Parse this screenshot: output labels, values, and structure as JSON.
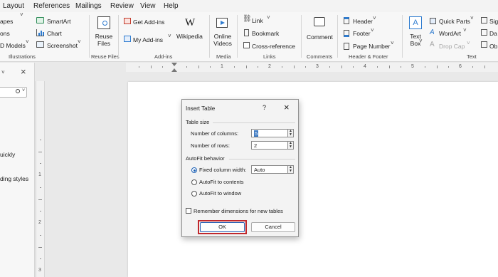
{
  "menubar": {
    "items": [
      "Layout",
      "References",
      "Mailings",
      "Review",
      "View",
      "Help"
    ]
  },
  "ribbon": {
    "illustrations": {
      "shapes": "apes",
      "smartart": "SmartArt",
      "icons": "ons",
      "chart": "Chart",
      "models": "D Models",
      "screenshot": "Screenshot",
      "label": "Illustrations"
    },
    "reuse_files": {
      "button": "Reuse\nFiles",
      "label": "Reuse Files"
    },
    "addins": {
      "get": "Get Add-ins",
      "my": "My Add-ins",
      "wikipedia": "Wikipedia",
      "label": "Add-ins"
    },
    "media": {
      "online_videos": "Online\nVideos",
      "label": "Media"
    },
    "links": {
      "link": "Link",
      "bookmark": "Bookmark",
      "cross_reference": "Cross-reference",
      "label": "Links"
    },
    "comments": {
      "comment": "Comment",
      "label": "Comments"
    },
    "header_footer": {
      "header": "Header",
      "footer": "Footer",
      "page_number": "Page Number",
      "label": "Header & Footer"
    },
    "text": {
      "text_box": "Text\nBox",
      "quick_parts": "Quick Parts",
      "wordart": "WordArt",
      "drop_cap": "Drop Cap",
      "sig": "Sig",
      "date": "Da",
      "obj": "Ob",
      "label": "Text"
    }
  },
  "navpane": {
    "close_glyph": "×",
    "text_quickly": "uickly",
    "text_styles": "ding styles"
  },
  "ruler": {
    "h_numbers": [
      "1",
      "2",
      "3",
      "4",
      "5",
      "6"
    ],
    "v_numbers": [
      "1",
      "2",
      "3"
    ]
  },
  "dialog": {
    "title": "Insert Table",
    "help": "?",
    "close": "×",
    "table_size_label": "Table size",
    "columns_label": "Number of columns:",
    "columns_value": "5",
    "rows_label": "Number of rows:",
    "rows_value": "2",
    "autofit_label": "AutoFit behavior",
    "fixed_label": "Fixed column width:",
    "fixed_value": "Auto",
    "autofit_contents": "AutoFit to contents",
    "autofit_window": "AutoFit to window",
    "remember": "Remember dimensions for new tables",
    "ok": "OK",
    "cancel": "Cancel"
  },
  "colors": {
    "accent": "#1a5fb4",
    "highlight_box": "#c0282d"
  }
}
